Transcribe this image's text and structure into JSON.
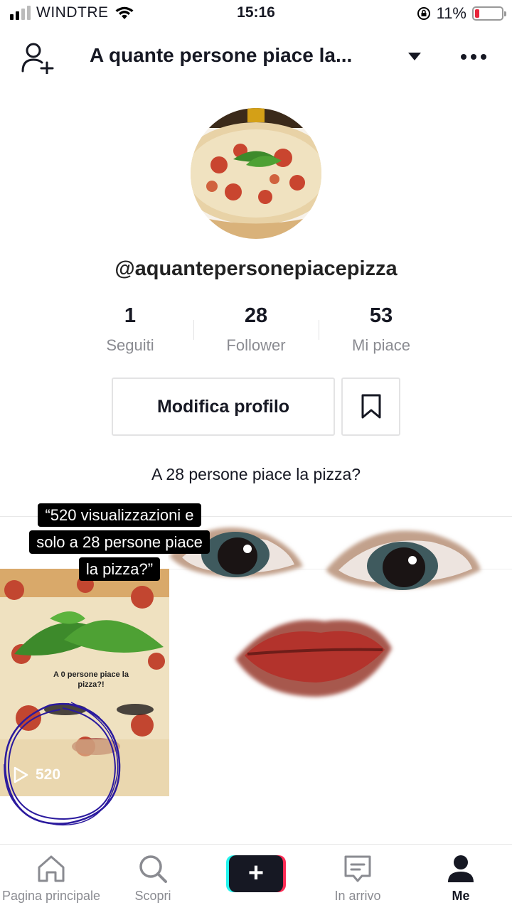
{
  "status_bar": {
    "carrier": "WINDTRE",
    "time": "15:16",
    "battery": "11%",
    "battery_level": 0.11
  },
  "header": {
    "title": "A quante persone piace la...",
    "add_user_icon": "add-user-icon",
    "dropdown_icon": "caret-down-icon",
    "more_icon": "more-dots-icon"
  },
  "profile": {
    "username": "@aquantepersonepiacepizza",
    "stats": [
      {
        "value": "1",
        "label": "Seguiti"
      },
      {
        "value": "28",
        "label": "Follower"
      },
      {
        "value": "53",
        "label": "Mi piace"
      }
    ],
    "edit_button": "Modifica profilo",
    "bookmark_icon": "bookmark-icon",
    "bio": "A 28 persone piace la pizza?"
  },
  "overlay_quote": {
    "lines": [
      "“520 visualizzazioni e",
      "solo a 28 persone piace",
      "la pizza?”"
    ]
  },
  "videos": [
    {
      "caption": "A 0 persone piace la pizza?!",
      "play_count": "520"
    }
  ],
  "bottom_nav": {
    "items": [
      {
        "label": "Pagina principale",
        "icon": "home-icon"
      },
      {
        "label": "Scopri",
        "icon": "search-icon"
      },
      {
        "label": "In arrivo",
        "icon": "inbox-icon"
      },
      {
        "label": "Me",
        "icon": "profile-icon",
        "active": true
      }
    ],
    "create_icon": "plus-icon"
  },
  "colors": {
    "accent_red": "#fe2c55",
    "accent_cyan": "#25f4ee",
    "text_primary": "#161823",
    "text_secondary": "#8a8b91",
    "annotation_circle": "#2b1a9e"
  }
}
